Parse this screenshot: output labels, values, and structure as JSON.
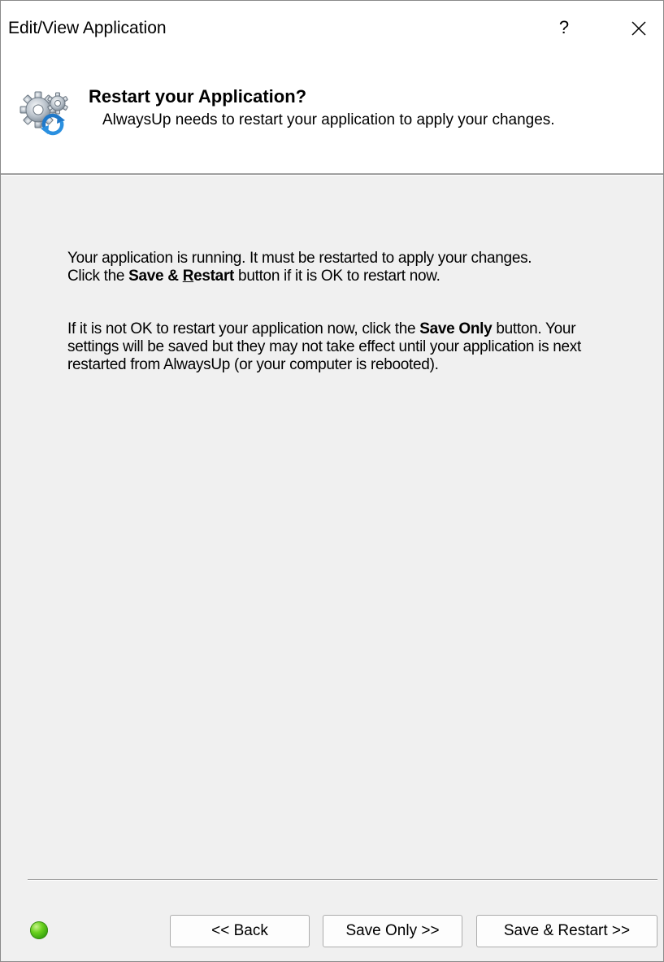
{
  "window": {
    "title": "Edit/View Application",
    "help_label": "?"
  },
  "header": {
    "title": "Restart your Application?",
    "subtitle": "AlwaysUp needs to restart your application to apply your changes.",
    "icon": "gears-restart-icon"
  },
  "body": {
    "para1_line1": "Your application is running. It must be restarted to apply your changes.",
    "para1_pre": "Click the ",
    "para1_bold_a": "Save & ",
    "para1_bold_ul": "R",
    "para1_bold_b": "estart",
    "para1_post": " button if it is OK to restart now.",
    "para2_pre": "If it is not OK to restart your application now, click the ",
    "para2_bold": "Save Only",
    "para2_post": " button. Your settings will be saved but they may not take effect until your application is next restarted from AlwaysUp (or your computer is rebooted)."
  },
  "status": {
    "color": "#3fb80f"
  },
  "buttons": {
    "back": "<< Back",
    "save_only": "Save Only >>",
    "save_restart": "Save & Restart >>"
  }
}
